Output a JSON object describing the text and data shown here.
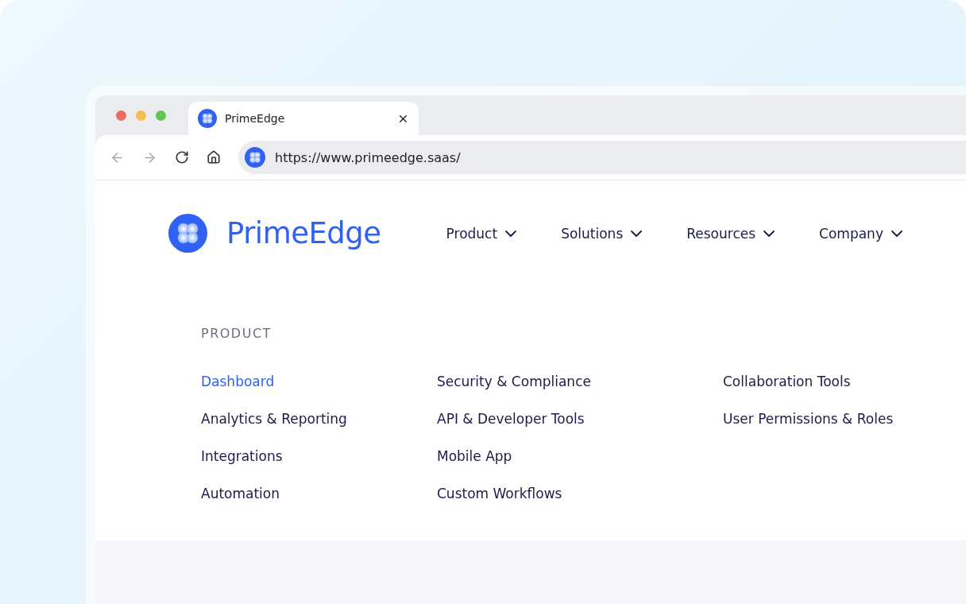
{
  "browser": {
    "tab_title": "PrimeEdge",
    "url": "https://www.primeedge.saas/"
  },
  "header": {
    "brand": "PrimeEdge",
    "nav": [
      {
        "label": "Product"
      },
      {
        "label": "Solutions"
      },
      {
        "label": "Resources"
      },
      {
        "label": "Company"
      }
    ]
  },
  "menu": {
    "heading": "PRODUCT",
    "columns": [
      [
        {
          "label": "Dashboard",
          "selected": true
        },
        {
          "label": "Analytics & Reporting",
          "selected": false
        },
        {
          "label": "Integrations",
          "selected": false
        },
        {
          "label": "Automation",
          "selected": false
        }
      ],
      [
        {
          "label": "Security & Compliance",
          "selected": false
        },
        {
          "label": "API & Developer Tools",
          "selected": false
        },
        {
          "label": "Mobile App",
          "selected": false
        },
        {
          "label": "Custom Workflows",
          "selected": false
        }
      ],
      [
        {
          "label": "Collaboration Tools",
          "selected": false
        },
        {
          "label": "User Permissions & Roles",
          "selected": false
        }
      ]
    ]
  }
}
